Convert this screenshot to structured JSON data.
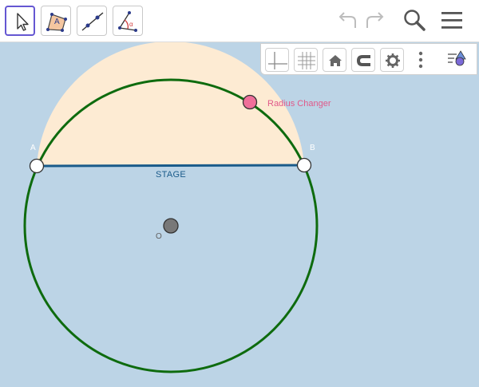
{
  "toolbar": {
    "tools": [
      {
        "name": "move-tool",
        "icon": "cursor-arrow-icon",
        "selected": true
      },
      {
        "name": "polygon-tool",
        "icon": "polygon-icon",
        "glyph": "A"
      },
      {
        "name": "line-tool",
        "icon": "line-through-points-icon"
      },
      {
        "name": "angle-tool",
        "icon": "angle-icon",
        "glyph": "α"
      }
    ],
    "right": [
      "undo-icon",
      "redo-icon",
      "search-icon",
      "menu-icon"
    ]
  },
  "style_bar": {
    "buttons": [
      "axes-icon",
      "grid-icon",
      "home-icon",
      "magnet-icon",
      "settings-icon",
      "more-vertical-icon",
      "algebra-view-icon"
    ]
  },
  "canvas": {
    "labels": {
      "point_a": "A",
      "point_b": "B",
      "center": "O",
      "stage": "STAGE",
      "radius_changer": "Radius Changer"
    }
  },
  "colors": {
    "canvas_bg": "#bcd4e6",
    "semicircle_fill": "#fdebd3",
    "circle_stroke": "#0e6b0e",
    "stage_line": "#1a5b8a",
    "radius_point": "#ef6f9a",
    "center_point": "#787878",
    "selected_tool_border": "#6557d2"
  }
}
